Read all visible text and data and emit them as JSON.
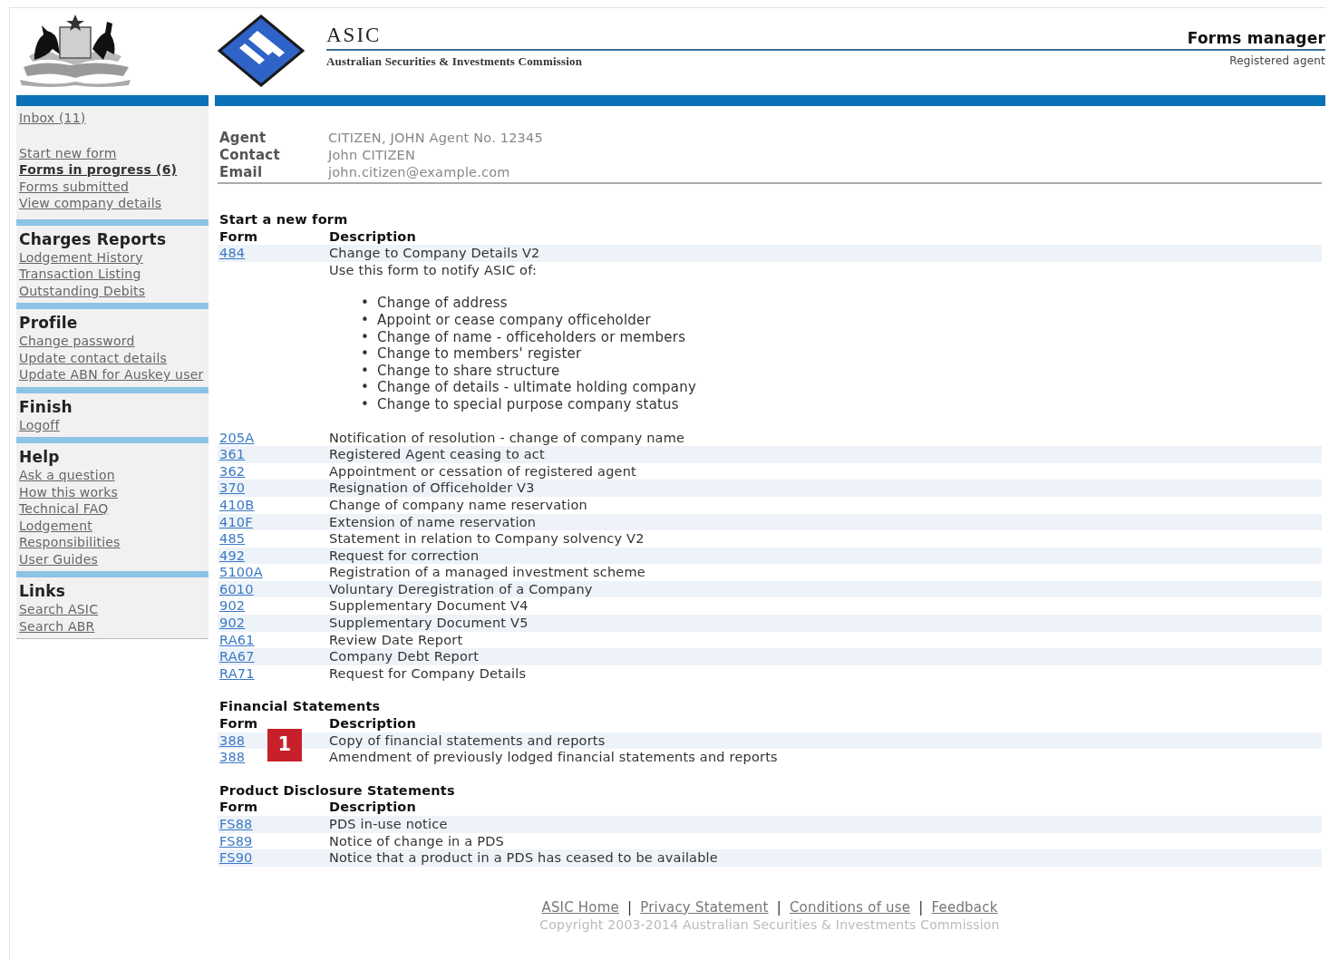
{
  "header": {
    "org_short": "ASIC",
    "org_full": "Australian Securities & Investments Commission",
    "app_title": "Forms manager",
    "role": "Registered agent"
  },
  "sidebar": {
    "sections": [
      {
        "links": [
          {
            "label": "Inbox (11)",
            "current": false
          }
        ]
      },
      {
        "links": [
          {
            "label": "Start new form",
            "current": false
          },
          {
            "label": "Forms in progress (6)",
            "current": true
          },
          {
            "label": "Forms submitted",
            "current": false
          },
          {
            "label": "View company details",
            "current": false
          }
        ]
      },
      {
        "heading": "Charges Reports",
        "links": [
          {
            "label": "Lodgement History",
            "current": false
          },
          {
            "label": "Transaction Listing",
            "current": false
          },
          {
            "label": "Outstanding Debits",
            "current": false
          }
        ]
      },
      {
        "heading": "Profile",
        "links": [
          {
            "label": "Change password",
            "current": false
          },
          {
            "label": "Update contact details",
            "current": false
          },
          {
            "label": "Update ABN for Auskey user",
            "current": false
          }
        ]
      },
      {
        "heading": "Finish",
        "links": [
          {
            "label": "Logoff",
            "current": false
          }
        ]
      },
      {
        "heading": "Help",
        "links": [
          {
            "label": "Ask a question",
            "current": false
          },
          {
            "label": "How this works",
            "current": false
          },
          {
            "label": "Technical FAQ",
            "current": false
          },
          {
            "label": "Lodgement",
            "current": false
          },
          {
            "label": "Responsibilities",
            "current": false
          },
          {
            "label": "User Guides",
            "current": false
          }
        ]
      },
      {
        "heading": "Links",
        "links": [
          {
            "label": "Search ASIC",
            "current": false
          },
          {
            "label": "Search ABR",
            "current": false
          }
        ]
      }
    ]
  },
  "agent": [
    {
      "label": "Agent",
      "value": "CITIZEN, JOHN Agent No. 12345"
    },
    {
      "label": "Contact",
      "value": "John CITIZEN"
    },
    {
      "label": "Email",
      "value": "john.citizen@example.com"
    }
  ],
  "form_groups": [
    {
      "title": "Start a new form",
      "columns": [
        "Form",
        "Description"
      ],
      "rows": [
        {
          "form": "484",
          "description": "Change to Company Details V2",
          "note": "Use this form to notify ASIC of:",
          "bullets": [
            {
              "marker": "•",
              "text": "Change of address"
            },
            {
              "marker": "•",
              "text": "Appoint or cease company officeholder"
            },
            {
              "marker": "•",
              "text": "Change of name - officeholders or members"
            },
            {
              "marker": "•",
              "text": "Change to members' register"
            },
            {
              "marker": "•",
              "text": "Change to share structure"
            },
            {
              "marker": "•",
              "text": "Change of details - ultimate holding company"
            },
            {
              "marker": "•",
              "text": "Change to special purpose company status"
            }
          ]
        },
        {
          "form": "205A",
          "description": "Notification of resolution - change of company name"
        },
        {
          "form": "361",
          "description": "Registered Agent ceasing to act"
        },
        {
          "form": "362",
          "description": "Appointment or cessation of registered agent"
        },
        {
          "form": "370",
          "description": "Resignation of Officeholder V3"
        },
        {
          "form": "410B",
          "description": "Change of company name reservation"
        },
        {
          "form": "410F",
          "description": "Extension of name reservation"
        },
        {
          "form": "485",
          "description": "Statement in relation to Company solvency V2"
        },
        {
          "form": "492",
          "description": "Request for correction"
        },
        {
          "form": "5100A",
          "description": "Registration of a managed investment scheme"
        },
        {
          "form": "6010",
          "description": "Voluntary Deregistration of a Company"
        },
        {
          "form": "902",
          "description": "Supplementary Document V4"
        },
        {
          "form": "902",
          "description": "Supplementary Document V5"
        },
        {
          "form": "RA61",
          "description": "Review Date Report"
        },
        {
          "form": "RA67",
          "description": "Company Debt Report"
        },
        {
          "form": "RA71",
          "description": "Request for Company Details"
        }
      ]
    },
    {
      "title": "Financial Statements",
      "columns": [
        "Form",
        "Description"
      ],
      "rows": [
        {
          "form": "388",
          "description": "Copy of financial statements and reports",
          "callout": "1"
        },
        {
          "form": "388",
          "description": "Amendment of previously lodged financial statements and reports"
        }
      ]
    },
    {
      "title": "Product Disclosure Statements",
      "columns": [
        "Form",
        "Description"
      ],
      "rows": [
        {
          "form": "FS88",
          "description": "PDS in-use notice"
        },
        {
          "form": "FS89",
          "description": "Notice of change in a PDS"
        },
        {
          "form": "FS90",
          "description": "Notice that a product in a PDS has ceased to be available"
        }
      ]
    }
  ],
  "footer": {
    "items": [
      {
        "kind": "link",
        "text": "ASIC Home"
      },
      {
        "kind": "separator",
        "text": "|"
      },
      {
        "kind": "link",
        "text": "Privacy Statement"
      },
      {
        "kind": "separator",
        "text": "|"
      },
      {
        "kind": "link",
        "text": "Conditions of use"
      },
      {
        "kind": "separator",
        "text": "|"
      },
      {
        "kind": "link",
        "text": "Feedback"
      }
    ],
    "copyright": "Copyright 2003-2014 Australian Securities & Investments Commission"
  }
}
